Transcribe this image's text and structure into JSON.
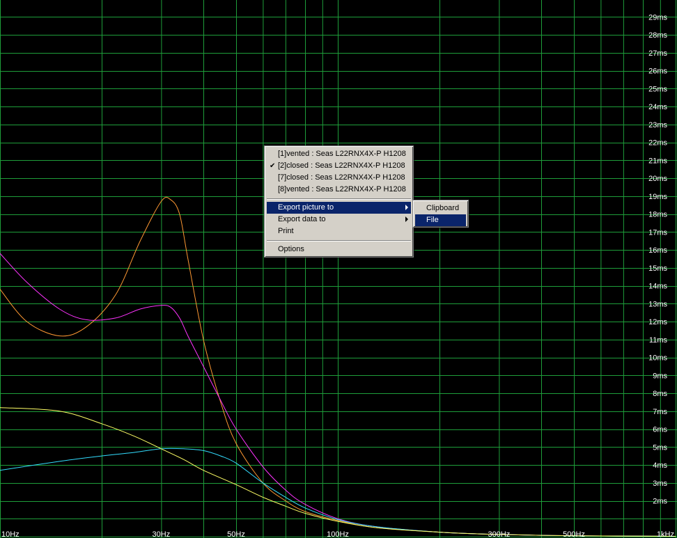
{
  "chart_data": {
    "type": "line",
    "x_scale": "log",
    "xlim": [
      10,
      1000
    ],
    "ylim": [
      0,
      30
    ],
    "x_ticks": [
      {
        "value": 10,
        "label": "10Hz"
      },
      {
        "value": 30,
        "label": "30Hz"
      },
      {
        "value": 50,
        "label": "50Hz"
      },
      {
        "value": 100,
        "label": "100Hz"
      },
      {
        "value": 300,
        "label": "300Hz"
      },
      {
        "value": 500,
        "label": "500Hz"
      },
      {
        "value": 1000,
        "label": "1kHz"
      }
    ],
    "y_tick_labels": [
      "2ms",
      "3ms",
      "4ms",
      "5ms",
      "6ms",
      "7ms",
      "8ms",
      "9ms",
      "10ms",
      "11ms",
      "12ms",
      "13ms",
      "14ms",
      "15ms",
      "16ms",
      "17ms",
      "18ms",
      "19ms",
      "20ms",
      "21ms",
      "22ms",
      "23ms",
      "24ms",
      "25ms",
      "26ms",
      "27ms",
      "28ms",
      "29ms"
    ],
    "grid": true,
    "series": [
      {
        "color": "#ff9933",
        "x": [
          10,
          12,
          15,
          18,
          22,
          26,
          30,
          32,
          34,
          36,
          40,
          45,
          50,
          60,
          70,
          80,
          100,
          130,
          200,
          300,
          500,
          1000
        ],
        "y": [
          13.8,
          12.0,
          11.2,
          11.7,
          13.5,
          16.5,
          18.7,
          18.8,
          18.0,
          15.5,
          11.0,
          7.5,
          5.2,
          3.0,
          2.0,
          1.4,
          0.9,
          0.5,
          0.25,
          0.12,
          0.05,
          0.02
        ]
      },
      {
        "color": "#ff33ff",
        "x": [
          10,
          12,
          15,
          18,
          22,
          26,
          30,
          32,
          34,
          36,
          40,
          45,
          50,
          60,
          70,
          80,
          100,
          130,
          200,
          300,
          500,
          1000
        ],
        "y": [
          15.8,
          14.2,
          12.7,
          12.1,
          12.2,
          12.7,
          12.9,
          12.8,
          12.2,
          11.2,
          9.5,
          7.6,
          6.0,
          3.9,
          2.6,
          1.8,
          1.0,
          0.55,
          0.25,
          0.12,
          0.05,
          0.02
        ]
      },
      {
        "color": "#33ddff",
        "x": [
          10,
          15,
          20,
          25,
          30,
          35,
          40,
          45,
          50,
          60,
          70,
          80,
          100,
          130,
          200,
          300,
          500,
          1000
        ],
        "y": [
          3.7,
          4.2,
          4.5,
          4.7,
          4.9,
          4.9,
          4.8,
          4.5,
          4.1,
          3.0,
          2.2,
          1.6,
          0.95,
          0.55,
          0.25,
          0.12,
          0.05,
          0.02
        ]
      },
      {
        "color": "#ffff66",
        "x": [
          10,
          15,
          20,
          25,
          30,
          35,
          40,
          50,
          60,
          70,
          80,
          100,
          130,
          200,
          300,
          500,
          1000
        ],
        "y": [
          7.2,
          7.0,
          6.3,
          5.6,
          4.9,
          4.3,
          3.7,
          2.9,
          2.2,
          1.7,
          1.3,
          0.85,
          0.5,
          0.25,
          0.12,
          0.05,
          0.02
        ]
      }
    ]
  },
  "colors": {
    "background": "#000000",
    "grid": "#1e9e3a",
    "menu_highlight": "#0a246a"
  },
  "context_menu": {
    "items": [
      {
        "label": "[1]vented : Seas L22RNX4X-P H1208",
        "checked": false
      },
      {
        "label": "[2]closed : Seas L22RNX4X-P H1208",
        "checked": true
      },
      {
        "label": "[7]closed : Seas L22RNX4X-P H1208",
        "checked": false
      },
      {
        "label": "[8]vented : Seas L22RNX4X-P H1208",
        "checked": false
      }
    ],
    "export_picture": "Export picture to",
    "export_data": "Export data to",
    "print": "Print",
    "options": "Options",
    "check_icon": "✔",
    "submenu": {
      "clipboard": "Clipboard",
      "file": "File"
    }
  }
}
